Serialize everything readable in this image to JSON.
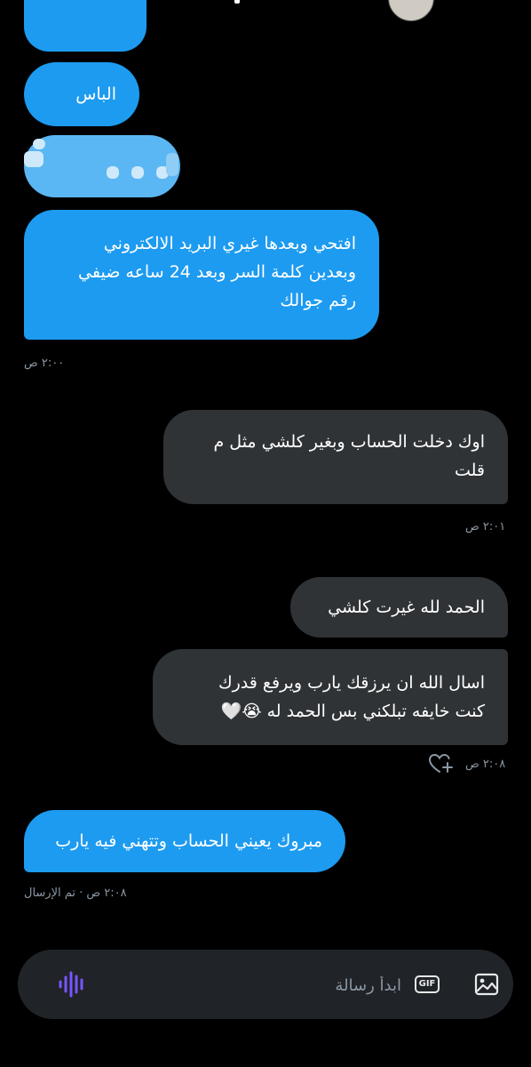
{
  "messages": [
    {
      "id": "m0",
      "text": ""
    },
    {
      "id": "m1",
      "text": "الباس"
    },
    {
      "id": "m3",
      "line1": "افتحي وبعدها غيري البريد الالكتروني",
      "line2": "وبعدين كلمة السر وبعد 24 ساعه ضيفي",
      "line3": "رقم جوالك"
    },
    {
      "id": "m4",
      "line1": "اوك دخلت الحساب وبغير كلشي مثل م",
      "line2": "قلت"
    },
    {
      "id": "m5",
      "text": "الحمد لله غيرت كلشي"
    },
    {
      "id": "m6",
      "line1": "اسال الله ان يرزقك يارب ويرفع قدرك",
      "line2": "كنت خايفه تبلكني بس الحمد له 😭🤍"
    },
    {
      "id": "m7",
      "text": "مبروك يعيني الحساب وتتهني فيه يارب"
    }
  ],
  "timestamps": {
    "t1": "٢:٠٠ ص",
    "t2": "٢:٠١ ص",
    "t3": "٢:٠٨ ص",
    "t4": "٢:٠٨ ص · تم الإرسال"
  },
  "composer": {
    "placeholder": "ابدأ رسالة",
    "gif_label": "GIF",
    "icons": [
      "voice-wave-icon",
      "gif-icon",
      "image-icon",
      "heart-plus-icon"
    ]
  },
  "colors": {
    "sent_bubble": "#1d9bf0",
    "received_bubble": "#2f3336",
    "voice_accent": "#7856ff"
  }
}
